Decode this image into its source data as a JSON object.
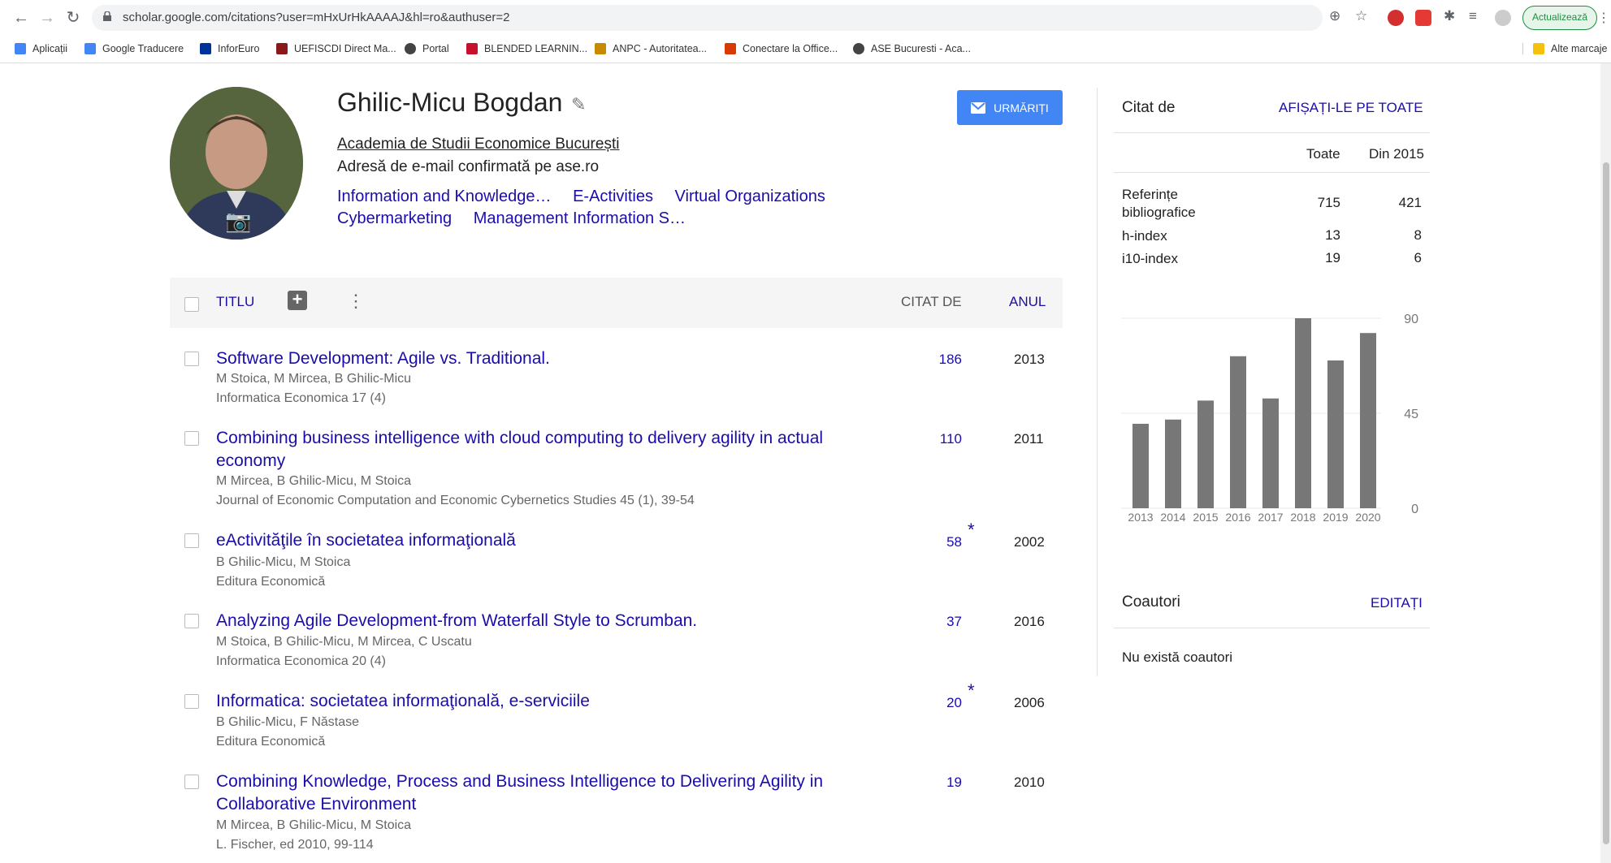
{
  "browser": {
    "url": "scholar.google.com/citations?user=mHxUrHkAAAAJ&hl=ro&authuser=2",
    "update_label": "Actualizează",
    "bookmarks": [
      {
        "label": "Aplicații",
        "icon": "apps-grid-icon",
        "color": "#4285f4"
      },
      {
        "label": "Google Traducere",
        "icon": "translate-icon",
        "color": "#4285f4"
      },
      {
        "label": "InforEuro",
        "icon": "eu-flag-icon",
        "color": "#003399"
      },
      {
        "label": "UEFISCDI Direct Ma...",
        "icon": "uefiscdi-icon",
        "color": "#8a1a1a"
      },
      {
        "label": "Portal",
        "icon": "globe-icon",
        "color": "#444"
      },
      {
        "label": "BLENDED LEARNIN...",
        "icon": "blended-icon",
        "color": "#c8102e"
      },
      {
        "label": "ANPC - Autoritatea...",
        "icon": "anpc-icon",
        "color": "#c88a00"
      },
      {
        "label": "Conectare la Office...",
        "icon": "office-icon",
        "color": "#d83b01"
      },
      {
        "label": "ASE Bucuresti - Aca...",
        "icon": "globe-icon",
        "color": "#444"
      }
    ],
    "other_bookmarks": "Alte marcaje"
  },
  "profile": {
    "name": "Ghilic-Micu Bogdan",
    "affiliation": "Academia de Studii Economice București",
    "email": "Adresă de e-mail confirmată pe ase.ro",
    "interests": [
      "Information and Knowledge…",
      "E-Activities",
      "Virtual Organizations",
      "Cybermarketing",
      "Management Information S…"
    ],
    "follow_label": "URMĂRIȚI"
  },
  "table": {
    "title_header": "TITLU",
    "cited_header": "CITAT DE",
    "year_header": "ANUL",
    "rows": [
      {
        "title": "Software Development: Agile vs. Traditional.",
        "authors": "M Stoica, M Mircea, B Ghilic-Micu",
        "source": "Informatica Economica 17 (4)",
        "cited": "186",
        "year": "2013",
        "star": ""
      },
      {
        "title": "Combining business intelligence with cloud computing to delivery agility in actual economy",
        "authors": "M Mircea, B Ghilic-Micu, M Stoica",
        "source": "Journal of Economic Computation and Economic Cybernetics Studies 45 (1), 39-54",
        "cited": "110",
        "year": "2011",
        "star": ""
      },
      {
        "title": "eActivităţile în societatea informaţională",
        "authors": "B Ghilic-Micu, M Stoica",
        "source": "Editura Economică",
        "cited": "58",
        "year": "2002",
        "star": "*"
      },
      {
        "title": "Analyzing Agile Development-from Waterfall Style to Scrumban.",
        "authors": "M Stoica, B Ghilic-Micu, M Mircea, C Uscatu",
        "source": "Informatica Economica 20 (4)",
        "cited": "37",
        "year": "2016",
        "star": ""
      },
      {
        "title": "Informatica: societatea informaţională, e-serviciile",
        "authors": "B Ghilic-Micu, F Năstase",
        "source": "Editura Economică",
        "cited": "20",
        "year": "2006",
        "star": "*"
      },
      {
        "title": "Combining Knowledge, Process and Business Intelligence to Delivering Agility in Collaborative Environment",
        "authors": "M Mircea, B Ghilic-Micu, M Stoica",
        "source": "L. Fischer, ed 2010, 99-114",
        "cited": "19",
        "year": "2010",
        "star": ""
      }
    ]
  },
  "cited_by": {
    "title": "Citat de",
    "show_all": "AFIȘAȚI-LE PE TOATE",
    "col_all": "Toate",
    "col_since": "Din 2015",
    "stats": [
      {
        "label": "Referințe bibliografice",
        "all": "715",
        "since": "421"
      },
      {
        "label": "h-index",
        "all": "13",
        "since": "8"
      },
      {
        "label": "i10-index",
        "all": "19",
        "since": "6"
      }
    ]
  },
  "chart_data": {
    "type": "bar",
    "categories": [
      "2013",
      "2014",
      "2015",
      "2016",
      "2017",
      "2018",
      "2019",
      "2020"
    ],
    "values": [
      40,
      42,
      51,
      72,
      52,
      90,
      70,
      83
    ],
    "ylim": [
      0,
      90
    ],
    "yticks": [
      "0",
      "45",
      "90"
    ],
    "bar_color": "#777777"
  },
  "coauthors": {
    "title": "Coautori",
    "edit": "EDITAȚI",
    "empty": "Nu există coautori"
  }
}
